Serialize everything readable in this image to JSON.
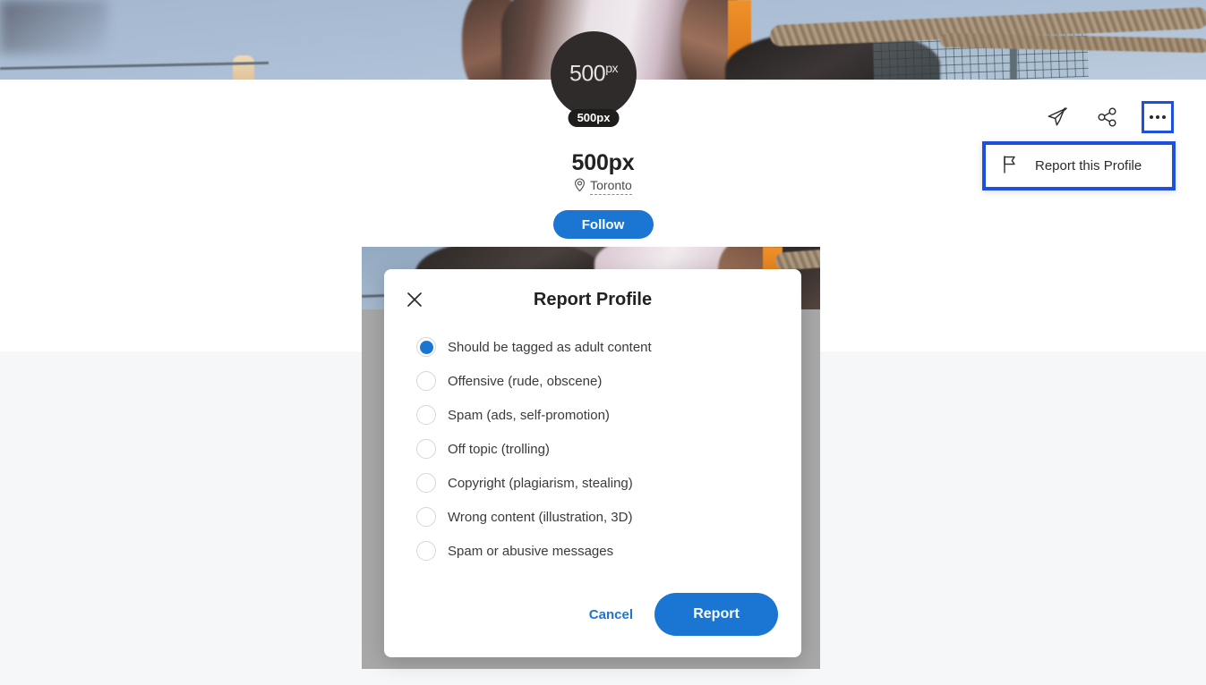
{
  "profile": {
    "avatar_logo": "500",
    "avatar_logo_sup": "px",
    "avatar_badge": "500px",
    "display_name": "500px",
    "location": "Toronto",
    "follow_label": "Follow",
    "location_icon": "map-pin-icon",
    "avatar_icon": "avatar-500px-logo"
  },
  "actions": {
    "send_icon": "send-icon",
    "share_icon": "share-icon",
    "more_icon": "more-options-icon"
  },
  "dropdown": {
    "flag_icon": "flag-icon",
    "report_profile_label": "Report this Profile"
  },
  "modal": {
    "title": "Report Profile",
    "close_icon": "close-icon",
    "options": [
      {
        "label": "Should be tagged as adult content",
        "selected": true
      },
      {
        "label": "Offensive (rude, obscene)",
        "selected": false
      },
      {
        "label": "Spam (ads, self-promotion)",
        "selected": false
      },
      {
        "label": "Off topic (trolling)",
        "selected": false
      },
      {
        "label": "Copyright (plagiarism, stealing)",
        "selected": false
      },
      {
        "label": "Wrong content (illustration, 3D)",
        "selected": false
      },
      {
        "label": "Spam or abusive messages",
        "selected": false
      }
    ],
    "cancel_label": "Cancel",
    "report_label": "Report"
  },
  "colors": {
    "accent_blue": "#1a76d2",
    "highlight_blue": "#1f4fe0",
    "page_background": "#f5f7f9",
    "panel_white": "#ffffff",
    "avatar_dark": "#2e2b2a",
    "card_gray": "#a8a8a8"
  }
}
